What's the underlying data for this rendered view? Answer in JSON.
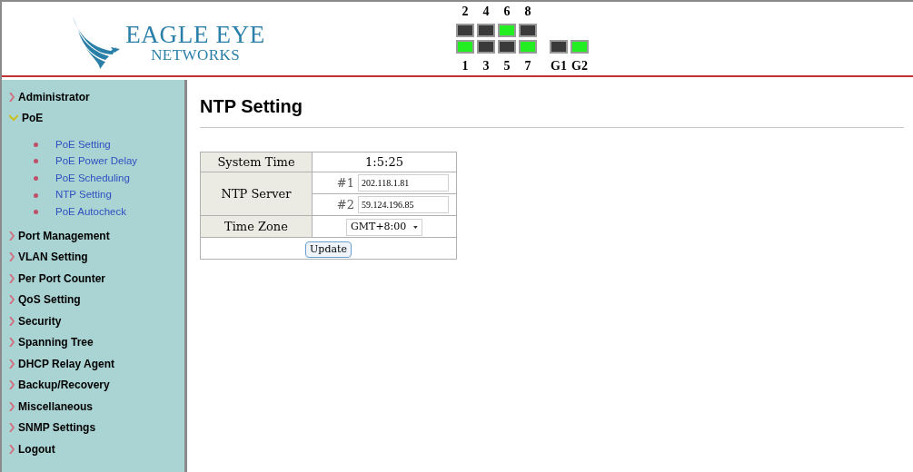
{
  "logo": {
    "line1": "EAGLE EYE",
    "line2": "NETWORKS"
  },
  "ports": {
    "top": [
      {
        "label": "2",
        "on": false
      },
      {
        "label": "4",
        "on": false
      },
      {
        "label": "6",
        "on": true
      },
      {
        "label": "8",
        "on": false
      }
    ],
    "bottom": [
      {
        "label": "1",
        "on": true
      },
      {
        "label": "3",
        "on": false
      },
      {
        "label": "5",
        "on": false
      },
      {
        "label": "7",
        "on": true
      }
    ],
    "uplinks": [
      {
        "label": "G1",
        "on": false
      },
      {
        "label": "G2",
        "on": true
      }
    ]
  },
  "sidebar": {
    "items": [
      {
        "label": "Administrator",
        "expanded": false
      },
      {
        "label": "PoE",
        "expanded": true,
        "children": [
          {
            "label": "PoE Setting"
          },
          {
            "label": "PoE Power Delay"
          },
          {
            "label": "PoE Scheduling"
          },
          {
            "label": "NTP Setting"
          },
          {
            "label": "PoE Autocheck"
          }
        ]
      },
      {
        "label": "Port Management",
        "expanded": false
      },
      {
        "label": "VLAN Setting",
        "expanded": false
      },
      {
        "label": "Per Port Counter",
        "expanded": false
      },
      {
        "label": "QoS Setting",
        "expanded": false
      },
      {
        "label": "Security",
        "expanded": false
      },
      {
        "label": "Spanning Tree",
        "expanded": false
      },
      {
        "label": "DHCP Relay Agent",
        "expanded": false
      },
      {
        "label": "Backup/Recovery",
        "expanded": false
      },
      {
        "label": "Miscellaneous",
        "expanded": false
      },
      {
        "label": "SNMP Settings",
        "expanded": false
      },
      {
        "label": "Logout",
        "expanded": false
      }
    ]
  },
  "page_title": "NTP Setting",
  "form": {
    "system_time": {
      "label": "System Time",
      "value": "1:5:25"
    },
    "ntp_server": {
      "label": "NTP Server",
      "servers": [
        {
          "index": "#1",
          "value": "202.118.1.81"
        },
        {
          "index": "#2",
          "value": "59.124.196.85"
        }
      ]
    },
    "time_zone": {
      "label": "Time Zone",
      "value": "GMT+8:00"
    },
    "update_button": "Update"
  }
}
